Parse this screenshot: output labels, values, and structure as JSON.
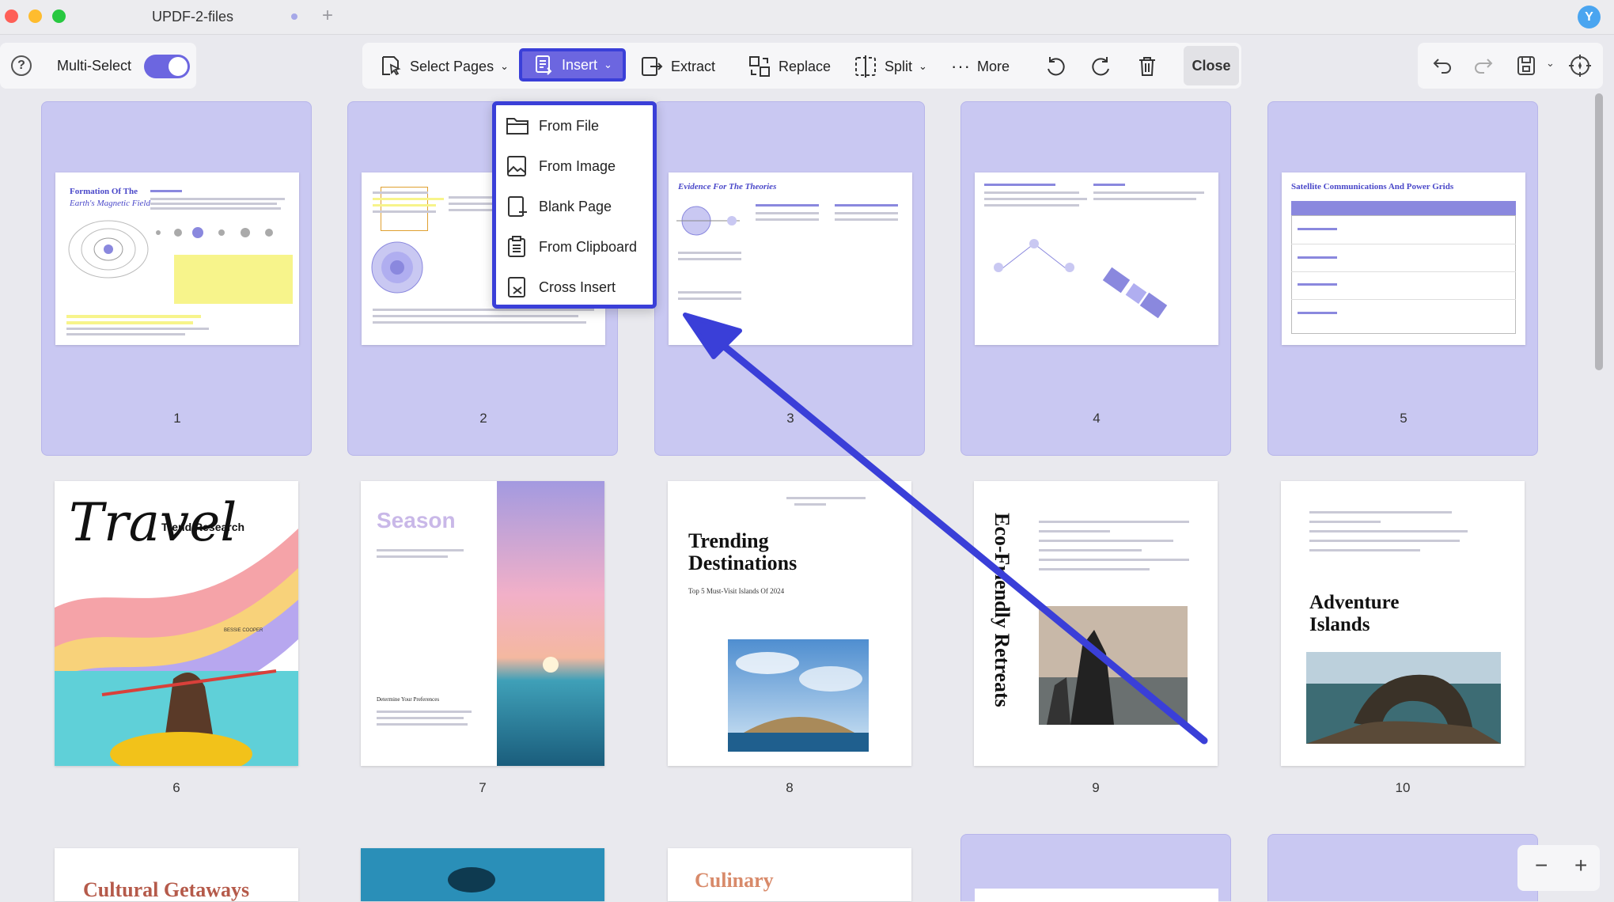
{
  "window": {
    "title": "UPDF-2-files",
    "avatar": "Y"
  },
  "toolbar": {
    "multi_select_label": "Multi-Select",
    "multi_select_on": true,
    "select_pages": "Select Pages",
    "insert": "Insert",
    "extract": "Extract",
    "replace": "Replace",
    "split": "Split",
    "more": "More",
    "close": "Close"
  },
  "insert_menu": {
    "items": [
      {
        "label": "From File",
        "icon": "folder-icon"
      },
      {
        "label": "From Image",
        "icon": "image-icon"
      },
      {
        "label": "Blank Page",
        "icon": "blank-page-icon"
      },
      {
        "label": "From Clipboard",
        "icon": "clipboard-icon"
      },
      {
        "label": "Cross Insert",
        "icon": "cross-insert-icon"
      }
    ]
  },
  "pages": [
    {
      "number": "1",
      "title": "Formation Of The",
      "subtitle": "Earth's Magnetic Field"
    },
    {
      "number": "2"
    },
    {
      "number": "3",
      "title": "Evidence For The Theories"
    },
    {
      "number": "4"
    },
    {
      "number": "5",
      "title": "Satellite Communications And Power Grids"
    },
    {
      "number": "6",
      "title": "Travel",
      "subtitle": "Trend Research",
      "author": "BESSIE COOPER"
    },
    {
      "number": "7",
      "title": "Season",
      "subhead": "Determine Your Preferences"
    },
    {
      "number": "8",
      "title": "Trending Destinations",
      "subtitle": "Top 5 Must-Visit Islands Of 2024"
    },
    {
      "number": "9",
      "title": "Eco-Friendly Retreats"
    },
    {
      "number": "10",
      "title": "Adventure Islands"
    },
    {
      "title": "Cultural Getaways"
    },
    {},
    {
      "title": "Culinary"
    }
  ],
  "zoom": {
    "minus": "−",
    "plus": "+"
  },
  "colors": {
    "accent": "#6c66e0",
    "highlight_border": "#3a3fd8",
    "selected_card": "#c9c8f2",
    "arrow": "#3a3fd8"
  }
}
